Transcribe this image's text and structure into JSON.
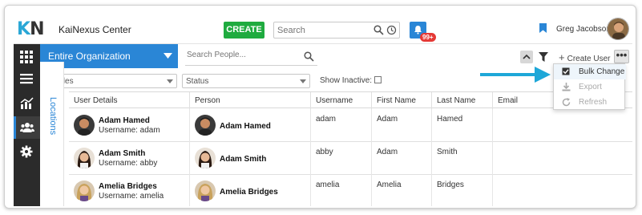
{
  "app": {
    "logo_k": "K",
    "logo_n": "N",
    "name": "KaiNexus Center",
    "create_label": "CREATE",
    "search_placeholder": "Search",
    "notification_badge": "99+",
    "user_name": "Greg Jacobson"
  },
  "org_selector": {
    "label": "Entire Organization"
  },
  "people_search": {
    "placeholder": "Search People..."
  },
  "locations_tab": "Locations",
  "toolbar": {
    "create_user_label": "Create User",
    "more_label": "•••"
  },
  "filters": {
    "roles_label": "Roles",
    "status_label": "Status",
    "show_inactive_label": "Show Inactive:"
  },
  "dropdown_menu": [
    {
      "label": "Bulk Change",
      "icon": "checkbox-checked-icon",
      "enabled": true
    },
    {
      "label": "Export",
      "icon": "download-icon",
      "enabled": false
    },
    {
      "label": "Refresh",
      "icon": "refresh-icon",
      "enabled": false
    }
  ],
  "table": {
    "columns": [
      "User Details",
      "Person",
      "Username",
      "First Name",
      "Last Name",
      "Email"
    ],
    "rows": [
      {
        "display_name": "Adam Hamed",
        "username_line": "Username: adam",
        "person": "Adam Hamed",
        "username": "adam",
        "first_name": "Adam",
        "last_name": "Hamed",
        "email": ""
      },
      {
        "display_name": "Adam Smith",
        "username_line": "Username: abby",
        "person": "Adam Smith",
        "username": "abby",
        "first_name": "Adam",
        "last_name": "Smith",
        "email": ""
      },
      {
        "display_name": "Amelia Bridges",
        "username_line": "Username: amelia",
        "person": "Amelia Bridges",
        "username": "amelia",
        "first_name": "Amelia",
        "last_name": "Bridges",
        "email": ""
      }
    ]
  },
  "colors": {
    "accent_blue": "#2a86d6",
    "create_green": "#1fab3f",
    "nav_dark": "#2b2b2b",
    "callout_arrow": "#1ea7d8",
    "badge_red": "#e53935"
  }
}
